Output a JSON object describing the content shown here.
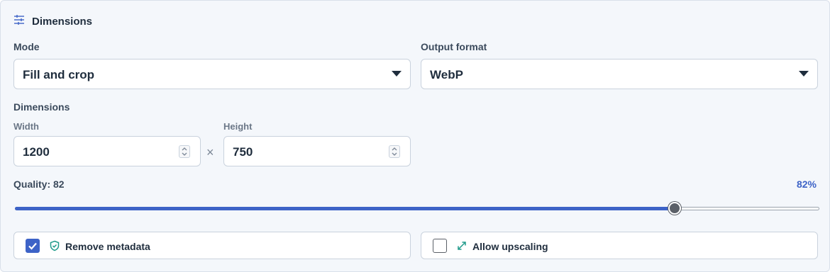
{
  "section": {
    "title": "Dimensions",
    "icon": "sliders-icon"
  },
  "mode": {
    "label": "Mode",
    "value": "Fill and crop"
  },
  "format": {
    "label": "Output format",
    "value": "WebP"
  },
  "dimensions": {
    "label": "Dimensions",
    "width_label": "Width",
    "width_value": "1200",
    "height_label": "Height",
    "height_value": "750",
    "separator": "×"
  },
  "quality": {
    "label": "Quality: 82",
    "percent_text": "82%",
    "value": 82,
    "min": 0,
    "max": 100
  },
  "options": {
    "remove_metadata": {
      "label": "Remove metadata",
      "checked": true,
      "icon": "shield-check-icon"
    },
    "allow_upscaling": {
      "label": "Allow upscaling",
      "checked": false,
      "icon": "expand-icon"
    }
  },
  "colors": {
    "accent": "#3d63c7",
    "teal": "#1f9a8a",
    "panel": "#f4f7fb"
  }
}
